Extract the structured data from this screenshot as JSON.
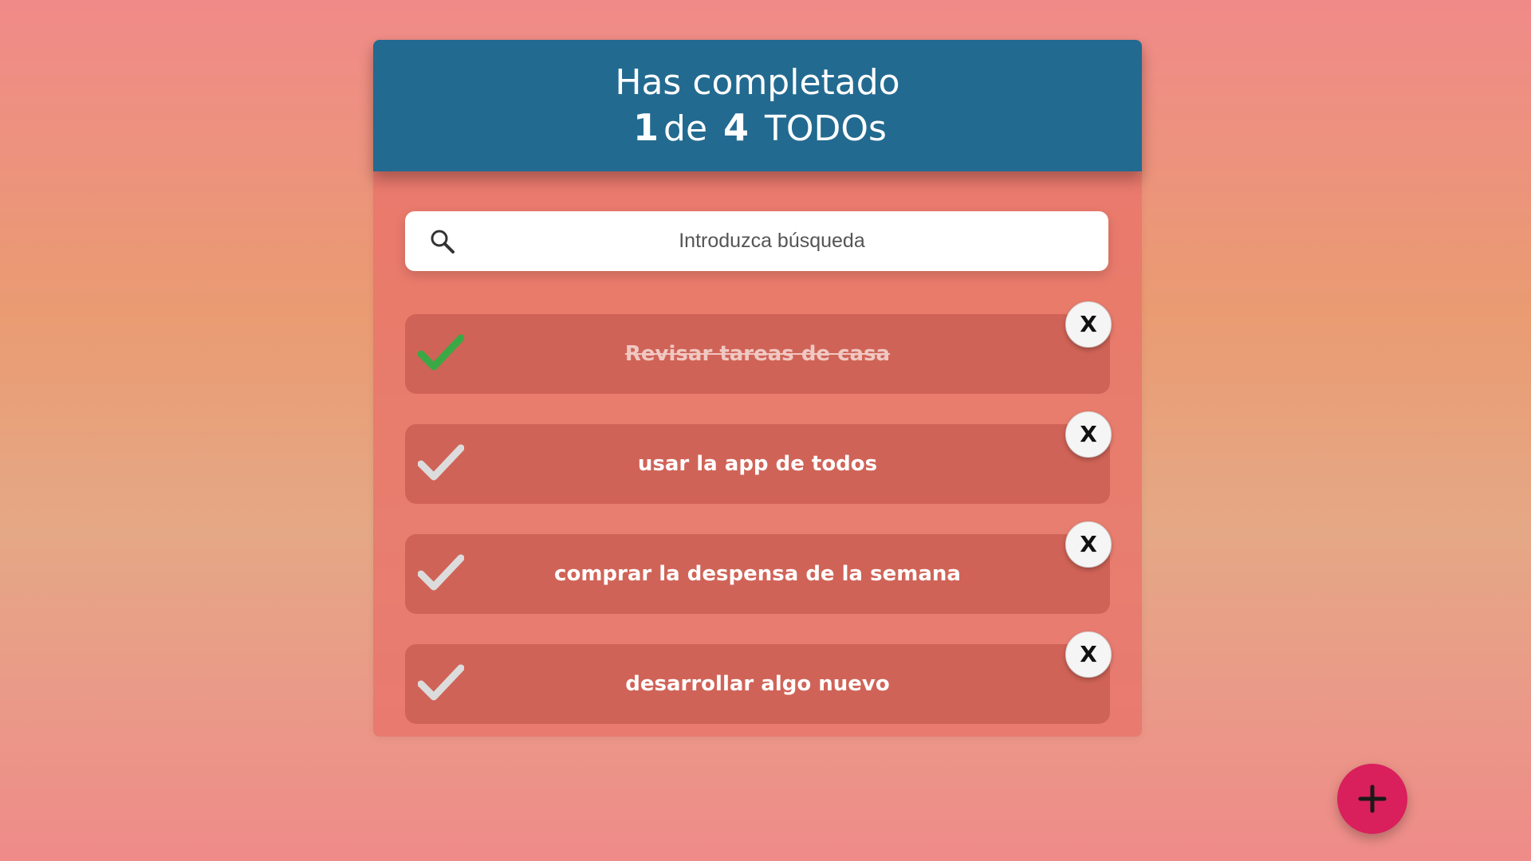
{
  "header": {
    "title": "Has completado",
    "completed_count": "1",
    "connector": "de",
    "total_count": "4",
    "suffix": "TODOs"
  },
  "search": {
    "placeholder": "Introduzca búsqueda",
    "value": "",
    "icon": "search-icon"
  },
  "todos": [
    {
      "text": "Revisar tareas de casa",
      "completed": true
    },
    {
      "text": "usar la app de todos",
      "completed": false
    },
    {
      "text": "comprar la despensa de la semana",
      "completed": false
    },
    {
      "text": "desarrollar algo nuevo",
      "completed": false
    }
  ],
  "delete_label": "X",
  "fab": {
    "icon": "plus-icon"
  },
  "colors": {
    "header_bg": "#236a90",
    "item_bg": "#d06357",
    "check_done": "#3aa845",
    "check_pending": "#dcdcdc",
    "fab_bg": "#d91f5c"
  }
}
